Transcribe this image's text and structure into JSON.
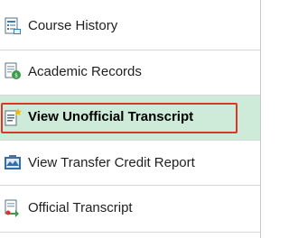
{
  "nav": {
    "items": [
      {
        "label": "Course History",
        "icon": "course-history-icon"
      },
      {
        "label": "Academic Records",
        "icon": "academic-records-icon"
      },
      {
        "label": "View Unofficial Transcript",
        "icon": "unofficial-transcript-icon",
        "selected": true
      },
      {
        "label": "View Transfer Credit Report",
        "icon": "transfer-credit-report-icon"
      },
      {
        "label": "Official Transcript",
        "icon": "official-transcript-icon"
      }
    ]
  },
  "colors": {
    "selected_bg": "#cdebd8",
    "highlight_border": "#d9362c",
    "divider": "#d6d6d6"
  }
}
